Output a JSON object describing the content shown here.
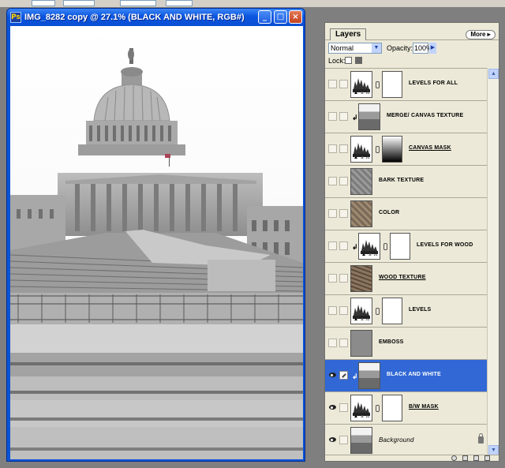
{
  "document": {
    "title": "IMG_8282 copy @ 27.1% (BLACK AND WHITE, RGB#)",
    "app_icon": "photoshop-doc-icon",
    "controls": {
      "minimize": "_",
      "maximize": "□",
      "close": "×"
    }
  },
  "layers_panel": {
    "tab_label": "Layers",
    "more_label": "More ▸",
    "blend_mode": "Normal",
    "opacity_label": "Opacity:",
    "opacity_value": "100%",
    "lock_label": "Lock:",
    "layers": [
      {
        "name": "LEVELS FOR ALL",
        "kind": "adjustment",
        "visible": false,
        "selected": false,
        "clipped": false
      },
      {
        "name": "MERGE/ CANVAS TEXTURE",
        "kind": "image",
        "visible": false,
        "selected": false,
        "clipped": true
      },
      {
        "name": "CANVAS MASK",
        "kind": "adjustment-gradient",
        "visible": false,
        "selected": false,
        "clipped": false,
        "underline": true
      },
      {
        "name": "BARK TEXTURE",
        "kind": "texture",
        "visible": false,
        "selected": false,
        "clipped": false
      },
      {
        "name": "COLOR",
        "kind": "texture-color",
        "visible": false,
        "selected": false,
        "clipped": false
      },
      {
        "name": "LEVELS FOR WOOD",
        "kind": "adjustment",
        "visible": false,
        "selected": false,
        "clipped": true
      },
      {
        "name": "WOOD TEXTURE",
        "kind": "texture-wood",
        "visible": false,
        "selected": false,
        "clipped": false,
        "underline": true
      },
      {
        "name": "LEVELS",
        "kind": "adjustment",
        "visible": false,
        "selected": false,
        "clipped": false
      },
      {
        "name": "EMBOSS",
        "kind": "emboss",
        "visible": false,
        "selected": false,
        "clipped": false
      },
      {
        "name": "BLACK AND WHITE",
        "kind": "image",
        "visible": true,
        "selected": true,
        "clipped": true
      },
      {
        "name": "B/W MASK",
        "kind": "adjustment",
        "visible": true,
        "selected": false,
        "clipped": false,
        "underline": true
      },
      {
        "name": "Background",
        "kind": "image",
        "visible": true,
        "selected": false,
        "clipped": false,
        "italic": true,
        "locked": true
      }
    ]
  }
}
